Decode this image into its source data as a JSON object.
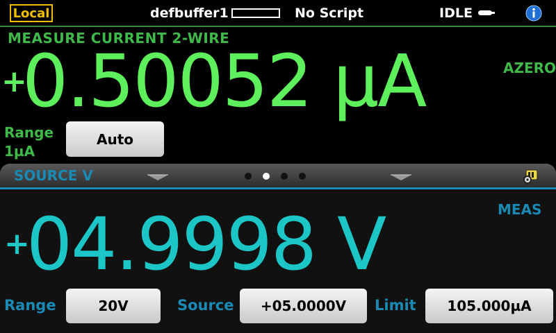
{
  "status": {
    "local_label": "Local",
    "buffer_name": "defbuffer1",
    "script_name": "No Script",
    "state": "IDLE"
  },
  "measure": {
    "title": "MEASURE CURRENT 2-WIRE",
    "sign": "+",
    "value": "0.50052 µA",
    "azero": "AZERO",
    "range_label_line1": "Range",
    "range_label_line2": "1µA",
    "range_button": "Auto",
    "color": "#5ef05c"
  },
  "source": {
    "title": "SOURCE V",
    "meas_label": "MEAS",
    "sign": "+",
    "value": "04.9998 V",
    "range_label": "Range",
    "range_button": "20V",
    "source_label": "Source",
    "source_button": "+05.0000V",
    "limit_label": "Limit",
    "limit_button": "105.000µA",
    "color": "#1cc6c6"
  },
  "pager": {
    "active_page": 2,
    "page_count": 4
  },
  "icons": {
    "idle": "idle-indicator-icon",
    "info": "info-icon",
    "settings": "settings-icon",
    "swipe_left": "swipe-handle-icon",
    "swipe_right": "swipe-handle-icon"
  }
}
